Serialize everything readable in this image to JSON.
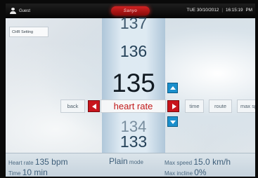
{
  "status_bar": {
    "user": "Guest",
    "brand": "Sanyo",
    "date": "TUE 30/10/2012",
    "time": "16:15:19",
    "ampm": "PM"
  },
  "side_tab": "CHR Setting",
  "wheel": {
    "values": [
      "137",
      "136",
      "135",
      "134",
      "133"
    ],
    "selected": "135"
  },
  "parameters": {
    "back": "back",
    "selected": "heart rate",
    "time": "time",
    "route": "route",
    "max": "max speed"
  },
  "info": {
    "heart_rate_label": "Heart rate",
    "heart_rate_value": "135 bpm",
    "time_label": "Time",
    "time_value": "10 min",
    "mode_value": "Plain",
    "mode_label": "mode",
    "max_speed_label": "Max speed",
    "max_speed_value": "15.0 km/h",
    "max_incline_label": "Max incline",
    "max_incline_value": "0%"
  },
  "colors": {
    "accent_red": "#c8141c",
    "accent_blue": "#1a8fcc"
  },
  "icons": [
    "person-icon",
    "arrow-left-icon",
    "arrow-right-icon",
    "arrow-up-icon",
    "arrow-down-icon"
  ]
}
